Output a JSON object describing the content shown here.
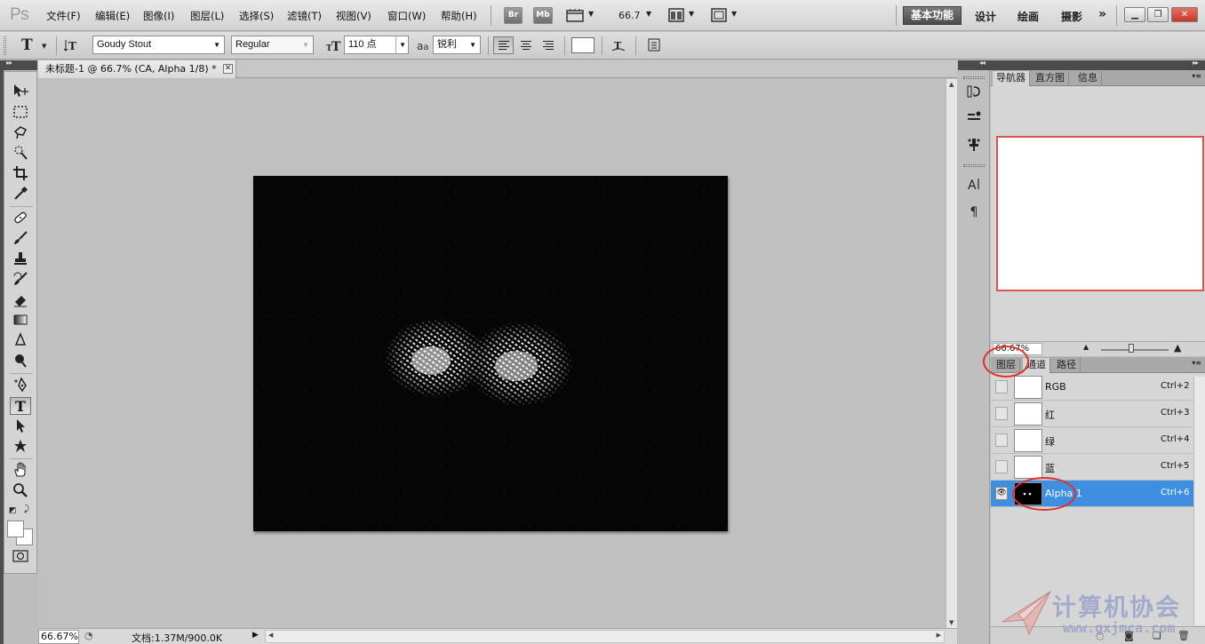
{
  "app": {
    "logo": "Ps"
  },
  "menu": {
    "items": [
      "文件(F)",
      "编辑(E)",
      "图像(I)",
      "图层(L)",
      "选择(S)",
      "滤镜(T)",
      "视图(V)",
      "窗口(W)",
      "帮助(H)"
    ],
    "bridge_label": "Br",
    "minibridge_label": "Mb",
    "zoom": "66.7"
  },
  "workspaces": {
    "active": "基本功能",
    "items": [
      "设计",
      "绘画",
      "摄影"
    ],
    "more": "»"
  },
  "options": {
    "font_family": "Goudy Stout",
    "font_style": "Regular",
    "font_size": "110 点",
    "antialias_prefix": "a",
    "antialias": "锐利",
    "text_color": "#ffffff"
  },
  "document": {
    "tab_title": "未标题-1 @ 66.7% (CA, Alpha 1/8) *"
  },
  "status": {
    "zoom": "66.67%",
    "doc_info": "文档:1.37M/900.0K"
  },
  "navigator": {
    "tabs": [
      "导航器",
      "直方图",
      "信息"
    ],
    "zoom": "66.67%"
  },
  "channels_panel": {
    "tabs": [
      "图层",
      "通道",
      "路径"
    ],
    "channels": [
      {
        "name": "RGB",
        "shortcut": "Ctrl+2",
        "visible": false,
        "selected": false
      },
      {
        "name": "红",
        "shortcut": "Ctrl+3",
        "visible": false,
        "selected": false
      },
      {
        "name": "绿",
        "shortcut": "Ctrl+4",
        "visible": false,
        "selected": false
      },
      {
        "name": "蓝",
        "shortcut": "Ctrl+5",
        "visible": false,
        "selected": false
      },
      {
        "name": "Alpha 1",
        "shortcut": "Ctrl+6",
        "visible": true,
        "selected": true
      }
    ]
  },
  "watermark": {
    "text": "计算机协会",
    "url": "www.gxjmca.com"
  },
  "colors": {
    "selection": "#3f8fe0",
    "annotation": "#e0302a",
    "active_workspace": "#4b4b4b"
  }
}
